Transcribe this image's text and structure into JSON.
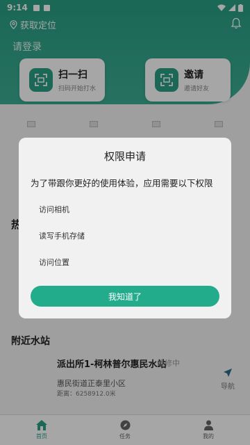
{
  "status_bar": {
    "time": "9:14"
  },
  "header": {
    "location_label": "获取定位",
    "login_label": "请登录"
  },
  "cards": [
    {
      "title": "扫一扫",
      "subtitle": "扫码开始打水"
    },
    {
      "title": "邀请",
      "subtitle": "邀请好友"
    }
  ],
  "section_hot": {
    "title": "热"
  },
  "section_nearby": {
    "title": "附近水站"
  },
  "station": {
    "name": "派出所1-柯林普尔惠民水站",
    "status": "维修中",
    "address": "惠民街道正泰里小区",
    "distance": "距离：6258912.0米",
    "nav_label": "导航"
  },
  "tabs": [
    {
      "label": "首页",
      "active": true
    },
    {
      "label": "任务",
      "active": false
    },
    {
      "label": "我的",
      "active": false
    }
  ],
  "dialog": {
    "title": "权限申请",
    "message": "为了带跟你更好的使用体验，应用需要以下权限",
    "permissions": [
      "访问相机",
      "读写手机存储",
      "访问位置"
    ],
    "confirm_label": "我知道了"
  },
  "colors": {
    "primary": "#2aa086",
    "button": "#23ac8c"
  }
}
